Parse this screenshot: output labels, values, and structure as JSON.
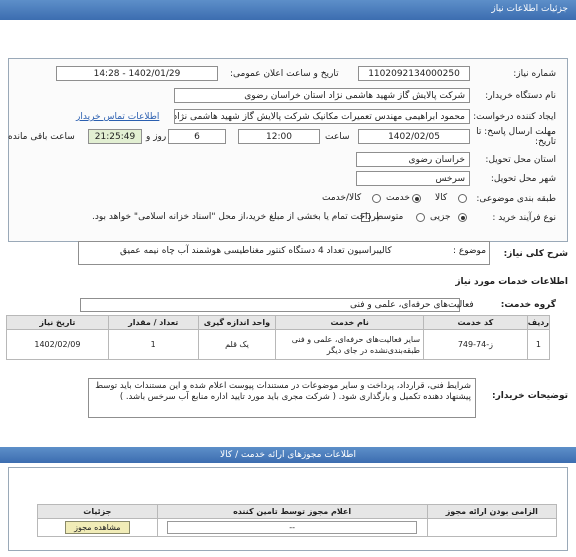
{
  "header": {
    "title": "جزئیات اطلاعات نیاز"
  },
  "need": {
    "number_label": "شماره نیاز:",
    "number": "1102092134000250",
    "announce_label": "تاریخ و ساعت اعلان عمومی:",
    "announce": "1402/01/29 - 14:28",
    "buyer_label": "نام دستگاه خریدار:",
    "buyer": "شرکت پالایش گاز شهید هاشمی نژاد   استان خراسان رضوی",
    "creator_label": "ایجاد کننده درخواست:",
    "creator": "محمود ابراهیمی مهندس تعمیرات مکانیک شرکت پالایش گاز شهید هاشمی نژاد",
    "contact_link": "اطلاعات تماس خریدار",
    "deadline_label": "مهلت ارسال پاسخ: تا",
    "deadline_label2": "تاریخ:",
    "deadline_date": "1402/02/05",
    "time_label": "ساعت",
    "deadline_time": "12:00",
    "days": "6",
    "days_label": "روز و",
    "remaining": "21:25:49",
    "remaining_label": "ساعت باقی مانده",
    "province_label": "استان محل تحویل:",
    "province": "خراسان رضوی",
    "city_label": "شهر محل تحویل:",
    "city": "سرخس",
    "category_label": "طبقه بندی موضوعی:",
    "category_options": [
      "کالا",
      "خدمت",
      "کالا/خدمت"
    ],
    "process_label": "نوع فرآیند خرید :",
    "process_options": [
      "جزیی",
      "متوسط"
    ],
    "payment_note": "پرداخت تمام یا بخشی از مبلغ خرید،از محل \"اسناد خزانه اسلامی\" خواهد بود."
  },
  "description": {
    "section_label": "شرح کلی نیاز:",
    "subject_label": "موضوع :",
    "subject": "کالیبراسیون تعداد 4 دستگاه کنتور مغناطیسی هوشمند آب چاه نیمه عمیق"
  },
  "services": {
    "section_label": "اطلاعات خدمات مورد نیاز",
    "group_label": "گروه خدمت:",
    "group": "فعالیت‌های حرفه‌ای، علمی و فنی",
    "columns": [
      "ردیف",
      "کد خدمت",
      "نام خدمت",
      "واحد اندازه گیری",
      "تعداد / مقدار",
      "تاریخ نیاز"
    ],
    "rows": [
      {
        "row": "1",
        "code": "ز-74-749",
        "name": "سایر فعالیت‌های حرفه‌ای، علمی و فنی طبقه‌بندی‌نشده در جای دیگر",
        "unit": "یک قلم",
        "qty": "1",
        "date": "1402/02/09"
      }
    ]
  },
  "notes": {
    "label": "توضیحات خریدار:",
    "text": "شرایط فنی، قرارداد، پرداخت و سایر موضوعات در مستندات پیوست اعلام شده و این مستندات باید توسط پیشنهاد دهنده تکمیل و  بارگذاری شود. ( شرکت مجری باید مورد تایید اداره منابع آب سرخس باشد. )"
  },
  "permits": {
    "title": "اطلاعات مجوزهای ارائه خدمت / کالا",
    "columns": [
      "الزامی بودن ارائه مجوز",
      "اعلام مجوز توسط تامین کننده",
      "جزئیات"
    ],
    "select_value": "--",
    "view_button": "مشاهده مجوز"
  }
}
